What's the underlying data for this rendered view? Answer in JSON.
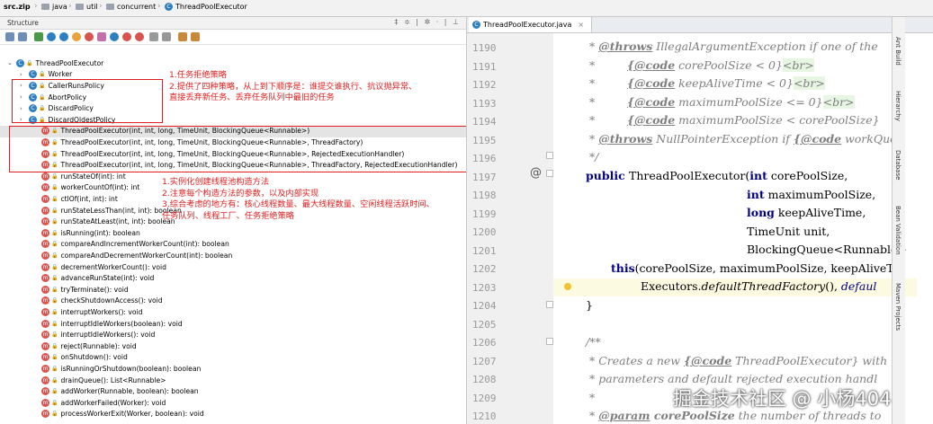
{
  "breadcrumb": [
    "src.zip",
    "java",
    "util",
    "concurrent",
    "ThreadPoolExecutor"
  ],
  "structure_panel": {
    "title": "Structure",
    "controls": "‡ ≑ | ✲ · | ⊥"
  },
  "tree": {
    "root": "ThreadPoolExecutor",
    "classes": [
      "Worker",
      "CallerRunsPolicy",
      "AbortPolicy",
      "DiscardPolicy",
      "DiscardOldestPolicy"
    ],
    "constructors": [
      "ThreadPoolExecutor(int, int, long, TimeUnit, BlockingQueue<Runnable>)",
      "ThreadPoolExecutor(int, int, long, TimeUnit, BlockingQueue<Runnable>, ThreadFactory)",
      "ThreadPoolExecutor(int, int, long, TimeUnit, BlockingQueue<Runnable>, RejectedExecutionHandler)",
      "ThreadPoolExecutor(int, int, long, TimeUnit, BlockingQueue<Runnable>, ThreadFactory, RejectedExecutionHandler)"
    ],
    "methods": [
      "runStateOf(int): int",
      "workerCountOf(int): int",
      "ctlOf(int, int): int",
      "runStateLessThan(int, int): boolean",
      "runStateAtLeast(int, int): boolean",
      "isRunning(int): boolean",
      "compareAndIncrementWorkerCount(int): boolean",
      "compareAndDecrementWorkerCount(int): boolean",
      "decrementWorkerCount(): void",
      "advanceRunState(int): void",
      "tryTerminate(): void",
      "checkShutdownAccess(): void",
      "interruptWorkers(): void",
      "interruptIdleWorkers(boolean): void",
      "interruptIdleWorkers(): void",
      "reject(Runnable): void",
      "onShutdown(): void",
      "isRunningOrShutdown(boolean): boolean",
      "drainQueue(): List<Runnable>",
      "addWorker(Runnable, boolean): boolean",
      "addWorkerFailed(Worker): void",
      "processWorkerExit(Worker, boolean): void"
    ]
  },
  "annotations": {
    "policy_note": [
      "1.任务拒绝策略",
      "2.提供了四种策略，从上到下顺序是：谁提交谁执行、抗议抛异常、",
      "直接丢弃新任务、丢弃任务队列中最旧的任务"
    ],
    "ctor_note": [
      "1.实例化创建线程池构造方法",
      "2.注意每个构造方法的参数，以及内部实现",
      "3.综合考虑的地方有：核心线程数量、最大线程数量、空闲线程活跃时间、",
      "任务队列、线程工厂、任务拒绝策略"
    ]
  },
  "editor": {
    "tab_label": "ThreadPoolExecutor.java",
    "line_numbers": [
      "1190",
      "1191",
      "1192",
      "1193",
      "1194",
      "1195",
      "1196",
      "1197",
      "1198",
      "1199",
      "1200",
      "1201",
      "1202",
      "1203",
      "1204",
      "1205",
      "1206",
      "1207",
      "1208",
      "1209",
      "1210"
    ],
    "code": {
      "l1190": [
        "* ",
        "@throws",
        " IllegalArgumentException ",
        "if one of the"
      ],
      "l1191": [
        "*         ",
        "{@code",
        " corePoolSize < 0}",
        "<br>"
      ],
      "l1192": [
        "*         ",
        "{@code",
        " keepAliveTime < 0}",
        "<br>"
      ],
      "l1193": [
        "*         ",
        "{@code",
        " maximumPoolSize <= 0}",
        "<br>"
      ],
      "l1194": [
        "*         ",
        "{@code",
        " maximumPoolSize < corePoolSize}"
      ],
      "l1195": [
        "* ",
        "@throws",
        " NullPointerException ",
        "if ",
        "{@code",
        " workQue"
      ],
      "l1196": "*/",
      "l1197": [
        "public ",
        "ThreadPoolExecutor(",
        "int",
        " corePoolSize,"
      ],
      "l1198": [
        "int",
        " maximumPoolSize,"
      ],
      "l1199": [
        "long",
        " keepAliveTime,"
      ],
      "l1200": "TimeUnit unit,",
      "l1201": "BlockingQueue<Runnable> ",
      "l1202": [
        "this",
        "(corePoolSize, maximumPoolSize, keepAliveT"
      ],
      "l1203": [
        "Executors.",
        "defaultThreadFactory",
        "(), ",
        "defaul"
      ],
      "l1204": "}",
      "l1206": "/**",
      "l1207": [
        "* Creates a new ",
        "{@code",
        " ThreadPoolExecutor} with"
      ],
      "l1208": "* parameters and default rejected execution handl",
      "l1209": "*",
      "l1210": [
        "* ",
        "@param",
        " corePoolSize",
        " the number of threads to"
      ]
    }
  },
  "right_sidebar": [
    "Ant Build",
    "Hierarchy",
    "Database",
    "Bean Validation",
    "Maven Projects"
  ],
  "watermark": "掘金技术社区 @ 小杨404",
  "colors": {
    "annotation_red": "#e02020",
    "keyword": "#000080",
    "comment": "#7f7f7f",
    "current_line": "#fcfae1"
  }
}
